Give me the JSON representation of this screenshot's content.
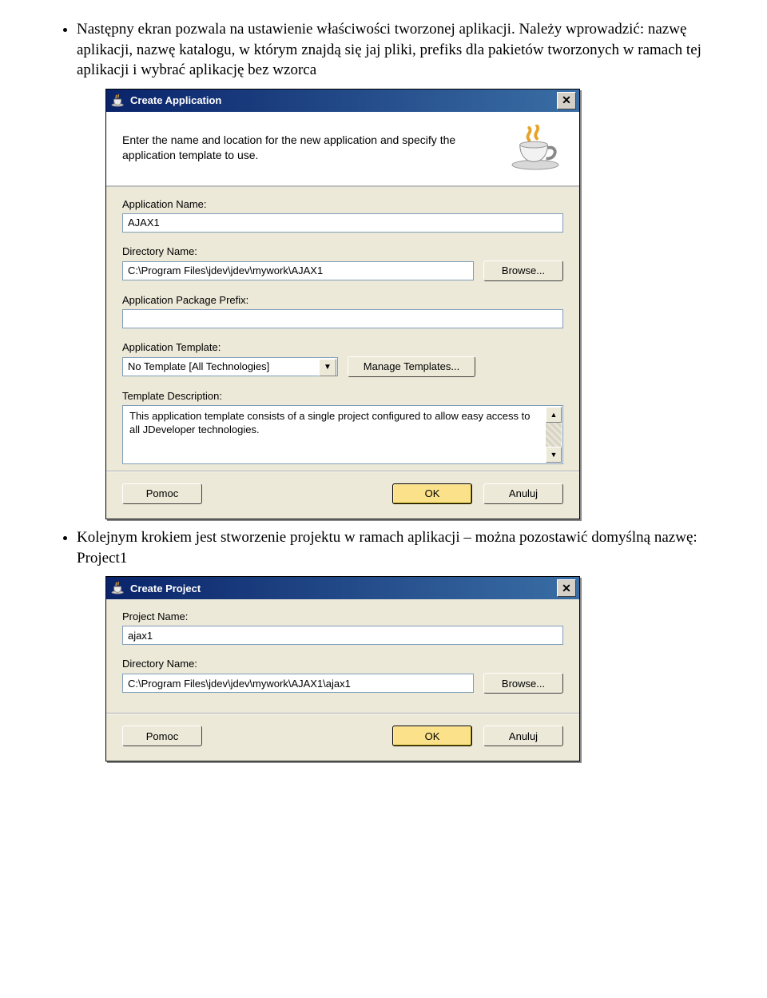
{
  "intro": {
    "bullet1": "Następny ekran pozwala na ustawienie właściwości tworzonej aplikacji. Należy wprowadzić: nazwę aplikacji, nazwę katalogu, w którym znajdą się jaj pliki, prefiks dla pakietów tworzonych w ramach tej aplikacji i wybrać aplikację bez wzorca",
    "bullet2": "Kolejnym krokiem jest stworzenie projektu w ramach aplikacji – można pozostawić domyślną nazwę: Project1"
  },
  "dialog1": {
    "title": "Create Application",
    "header_text": "Enter the name and location for the new application and specify the application template to use.",
    "labels": {
      "app_name": "Application Name:",
      "dir_name": "Directory Name:",
      "pkg_prefix": "Application Package Prefix:",
      "app_template": "Application Template:",
      "template_desc": "Template Description:"
    },
    "values": {
      "app_name": "AJAX1",
      "dir_name": "C:\\Program Files\\jdev\\jdev\\mywork\\AJAX1",
      "pkg_prefix": "",
      "app_template": "No Template [All Technologies]",
      "template_desc": "This application template consists of a single project configured to allow easy access to all JDeveloper technologies."
    },
    "buttons": {
      "browse": "Browse...",
      "manage": "Manage Templates...",
      "help": "Pomoc",
      "ok": "OK",
      "cancel": "Anuluj"
    }
  },
  "dialog2": {
    "title": "Create Project",
    "labels": {
      "proj_name": "Project Name:",
      "dir_name": "Directory Name:"
    },
    "values": {
      "proj_name": "ajax1",
      "dir_name": "C:\\Program Files\\jdev\\jdev\\mywork\\AJAX1\\ajax1"
    },
    "buttons": {
      "browse": "Browse...",
      "help": "Pomoc",
      "ok": "OK",
      "cancel": "Anuluj"
    }
  }
}
